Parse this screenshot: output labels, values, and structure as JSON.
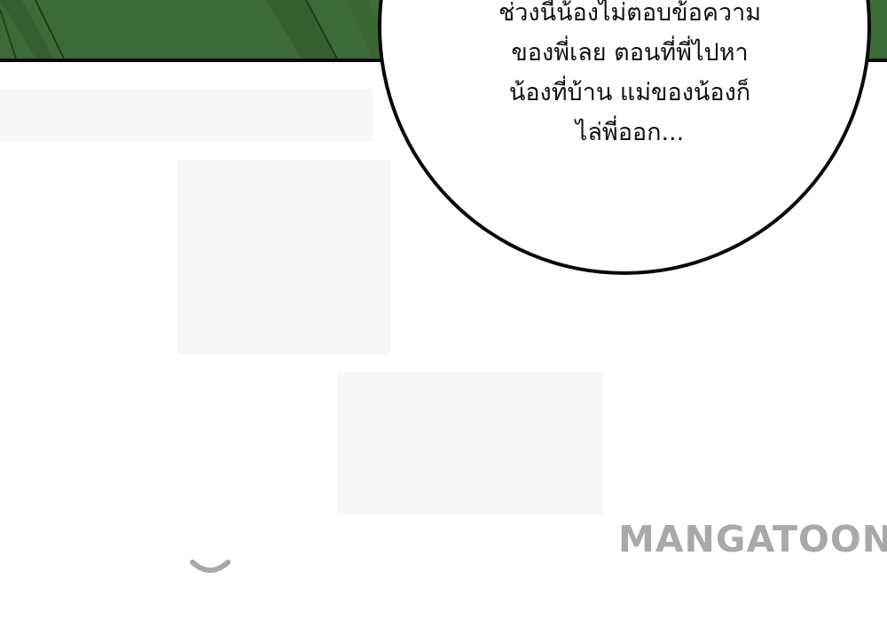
{
  "scene": {
    "panel_color": "#3d6b37",
    "border_color": "#0a0a0a"
  },
  "speech_bubble": {
    "lines": [
      "ช่วงนี้น้องไม่ตอบข้อความ",
      "ของพี่เลย ตอนที่พี่ไปหา",
      "น้องที่บ้าน แม่ของน้องก็",
      "ไล่พี่ออก..."
    ]
  },
  "watermark": {
    "text": "MANGATOON",
    "color": "#a9a9a9"
  }
}
